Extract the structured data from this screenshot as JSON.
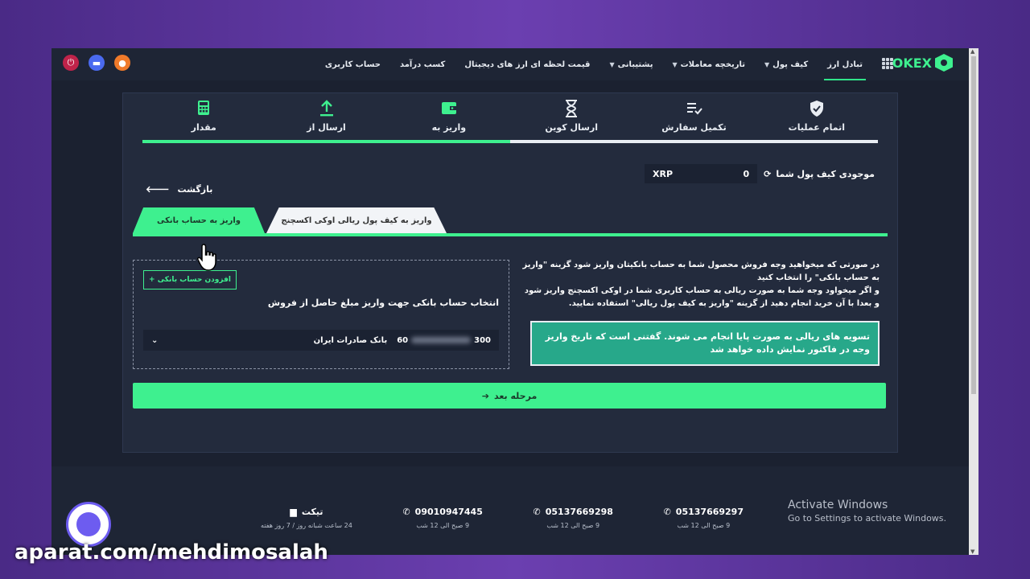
{
  "nav": {
    "items": [
      {
        "label": "تبادل ارز",
        "active": true,
        "chevron": false
      },
      {
        "label": "کیف پول",
        "active": false,
        "chevron": true
      },
      {
        "label": "تاریخچه معاملات",
        "active": false,
        "chevron": true
      },
      {
        "label": "پشتیبانی",
        "active": false,
        "chevron": true
      },
      {
        "label": "قیمت لحظه ای ارز های دیجیتال",
        "active": false,
        "chevron": false
      },
      {
        "label": "کسب درآمد",
        "active": false,
        "chevron": false
      },
      {
        "label": "حساب کاربری",
        "active": false,
        "chevron": false
      }
    ],
    "logo_text": "OKEX"
  },
  "steps": [
    {
      "label": "اتمام عملیات",
      "icon": "shield-check-icon"
    },
    {
      "label": "تکمیل سفارش",
      "icon": "list-check-icon"
    },
    {
      "label": "ارسال کوین",
      "icon": "hourglass-icon"
    },
    {
      "label": "واریز به",
      "icon": "wallet-icon"
    },
    {
      "label": "ارسال از",
      "icon": "upload-icon"
    },
    {
      "label": "مقدار",
      "icon": "calculator-icon"
    }
  ],
  "progress": 0.5,
  "balance": {
    "label": "موجودی کیف پول شما",
    "amount": "0",
    "currency": "XRP"
  },
  "back_label": "بازگشت",
  "tabs": {
    "active": "واریز به حساب بانکی",
    "inactive": "واریز به کیف پول ریالی اوکی اکسچنج"
  },
  "bank": {
    "add_button": "افزودن حساب بانکی",
    "select_label": "انتخاب حساب بانکی جهت واریز مبلغ حاصل از فروش",
    "account_prefix": "60",
    "account_suffix": "300",
    "bank_name": "بانک صادرات ایران"
  },
  "info": {
    "line1_a": "در صورتی که میخواهید وجه فروش محصول شما به حساب بانکیتان واریز شود گزینه ",
    "line1_b": "\"واریز به حساب بانکی\"",
    "line1_c": " را انتخاب کنید",
    "line2_a": "و اگر میخواود وجه شما به صورت ریالی به حساب کاربری شما در اوکی اکسچنج واریز شود و بعدا با آن خرید انجام دهید از گزینه ",
    "line2_b": "\"واریز به کیف پول ریالی\"",
    "line2_c": " استفاده نمایید."
  },
  "notice": "تسویه های ریالی به صورت پایا انجام می شوند. گفتنی است که تاریخ واریز وجه در فاکتور نمایش داده خواهد شد",
  "next_button": "مرحله بعد",
  "footer": {
    "contacts": [
      {
        "value": "05137669297",
        "sub": "9 صبح الی 12 شب"
      },
      {
        "value": "05137669298",
        "sub": "9 صبح الی 12 شب"
      },
      {
        "value": "09010947445",
        "sub": "9 صبح الی 12 شب"
      },
      {
        "value": "تیکت",
        "sub": "24 ساعت شبانه روز / 7 روز هفته"
      }
    ],
    "activate_title": "Activate Windows",
    "activate_sub": "Go to Settings to activate Windows."
  },
  "watermark": "aparat.com/mehdimosalah",
  "colors": {
    "accent": "#3ef08f",
    "background": "#1b2130",
    "card": "#232b3d",
    "notice": "#27a88a"
  }
}
